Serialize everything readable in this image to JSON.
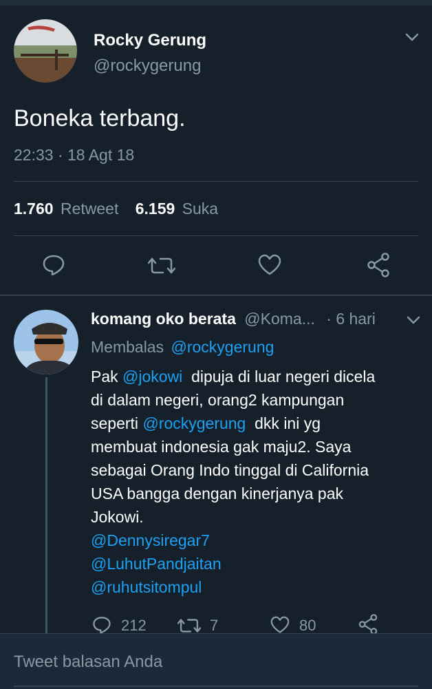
{
  "tweet": {
    "author_name": "Rocky Gerung",
    "handle": "@rockygerung",
    "text": "Boneka terbang.",
    "timestamp": "22:33 · 18 Agt 18",
    "retweet_count": "1.760",
    "retweet_label": "Retweet",
    "like_count": "6.159",
    "like_label": "Suka"
  },
  "reply": {
    "author_name": "komang oko berata",
    "handle": "@Koma...",
    "time": "· 6 hari",
    "replying_prefix": "Membalas",
    "replying_to": "@rockygerung",
    "line1_a": "Pak",
    "line1_mention": "@jokowi",
    "line1_b": "dipuja di luar negeri dicela",
    "line2": "di dalam negeri, orang2 kampungan",
    "line3_a": "seperti",
    "line3_mention": "@rockygerung",
    "line3_b": "dkk ini yg",
    "line4": "membuat indonesia gak maju2. Saya",
    "line5": "sebagai Orang Indo tinggal di California",
    "line6": "USA bangga dengan kinerjanya pak",
    "line7": "Jokowi.",
    "mention1": "@Dennysiregar7",
    "mention2": "@LuhutPandjaitan",
    "mention3": "@ruhutsitompul",
    "reply_count": "212",
    "retweet_count": "7",
    "like_count": "80"
  },
  "composer": {
    "placeholder": "Tweet balasan Anda"
  },
  "icons": [
    "chevron-down-icon",
    "reply-icon",
    "retweet-icon",
    "heart-icon",
    "share-icon"
  ],
  "colors": {
    "background": "#15202b",
    "link": "#1da1f2",
    "muted": "#8899a6",
    "divider": "#38444d"
  }
}
